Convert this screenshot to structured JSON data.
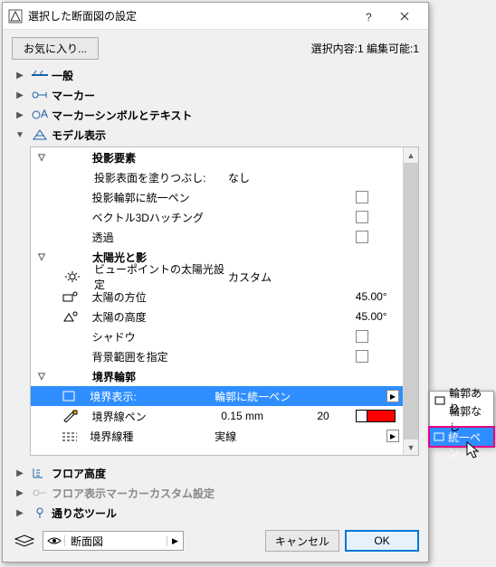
{
  "title": "選択した断面図の設定",
  "favorites_btn": "お気に入り...",
  "status": "選択内容:1 編集可能:1",
  "groups": [
    {
      "label": "一般",
      "expanded": false
    },
    {
      "label": "マーカー",
      "expanded": false
    },
    {
      "label": "マーカーシンボルとテキスト",
      "expanded": false
    },
    {
      "label": "モデル表示",
      "expanded": true
    }
  ],
  "sections": {
    "proj": {
      "label": "投影要素",
      "rows": [
        {
          "label": "投影表面を塗りつぶし:",
          "val": "なし"
        },
        {
          "label": "投影輪郭に統一ペン",
          "chk": true
        },
        {
          "label": "ベクトル3Dハッチング",
          "chk": true
        },
        {
          "label": "透過",
          "chk": true
        }
      ]
    },
    "sun": {
      "label": "太陽光と影",
      "rows": [
        {
          "label": "ビューポイントの太陽光設定",
          "val": "カスタム"
        },
        {
          "label": "太陽の方位",
          "val": "45.00°"
        },
        {
          "label": "太陽の高度",
          "val": "45.00°"
        },
        {
          "label": "シャドウ",
          "chk": true
        },
        {
          "label": "背景範囲を指定",
          "chk": true
        }
      ]
    },
    "bound": {
      "label": "境界輪郭",
      "rows": [
        {
          "label": "境界表示:",
          "val": "輪郭に統一ペン",
          "dd": true,
          "selected": true
        },
        {
          "label": "境界線ペン",
          "val": "0.15 mm",
          "val2": "20",
          "swatch": true
        },
        {
          "label": "境界線種",
          "val": "実線",
          "dd": true
        }
      ]
    }
  },
  "bottom_groups": [
    {
      "label": "フロア高度"
    },
    {
      "label": "フロア表示マーカーカスタム設定",
      "dim": true
    },
    {
      "label": "通り芯ツール"
    }
  ],
  "footer_combo": "断面図",
  "cancel": "キャンセル",
  "ok": "OK",
  "popup": {
    "items": [
      {
        "label": "輪郭あり"
      },
      {
        "label": "輪郭なし"
      },
      {
        "label": "輪郭に統一ペン",
        "hl": true
      }
    ]
  }
}
